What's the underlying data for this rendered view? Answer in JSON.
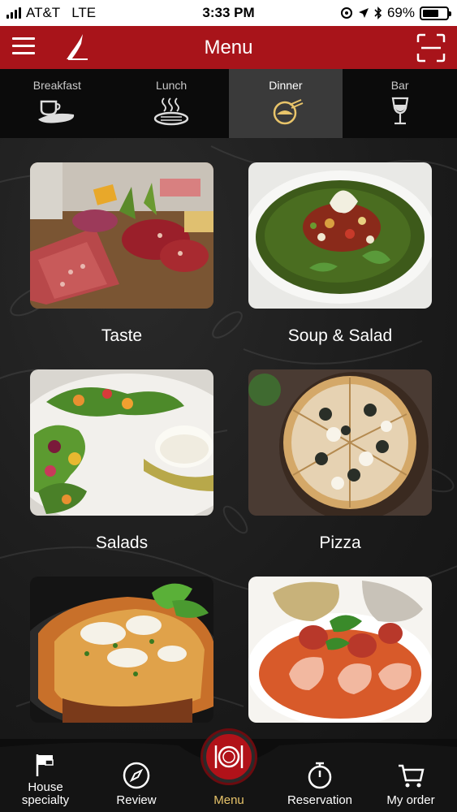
{
  "status_bar": {
    "carrier": "AT&T",
    "network": "LTE",
    "time": "3:33 PM",
    "battery_percent": "69%",
    "battery_level": 0.69
  },
  "header": {
    "title": "Menu",
    "accent_color": "#a8141a"
  },
  "tabs": [
    {
      "label": "Breakfast",
      "icon": "coffee-bread-icon",
      "active": false
    },
    {
      "label": "Lunch",
      "icon": "steak-plate-icon",
      "active": false
    },
    {
      "label": "Dinner",
      "icon": "dinner-plate-icon",
      "active": true
    },
    {
      "label": "Bar",
      "icon": "wine-glass-icon",
      "active": false
    }
  ],
  "categories": [
    {
      "label": "Taste"
    },
    {
      "label": "Soup & Salad"
    },
    {
      "label": "Salads"
    },
    {
      "label": "Pizza"
    },
    {
      "label": ""
    },
    {
      "label": ""
    }
  ],
  "bottom_nav": {
    "items": [
      {
        "label": "House specialty",
        "icon": "flag-icon"
      },
      {
        "label": "Review",
        "icon": "compass-icon"
      },
      {
        "label": "Menu",
        "icon": "plate-cutlery-icon",
        "active": true
      },
      {
        "label": "Reservation",
        "icon": "stopwatch-icon"
      },
      {
        "label": "My order",
        "icon": "cart-icon"
      }
    ],
    "active_color": "#e8c46a"
  }
}
